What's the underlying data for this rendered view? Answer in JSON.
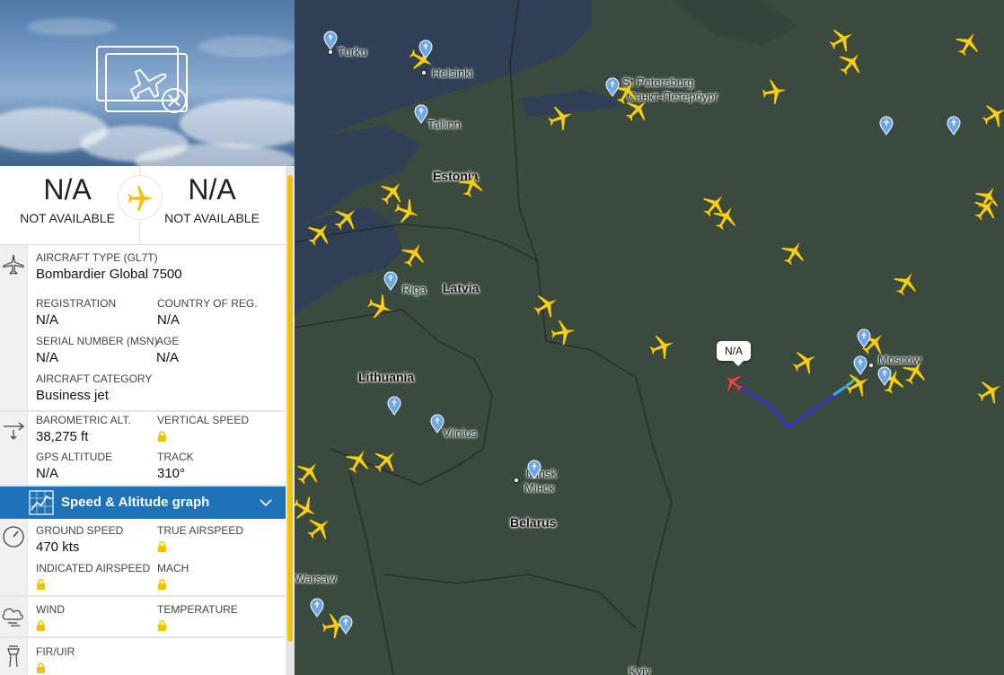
{
  "route": {
    "origin_code": "N/A",
    "origin_name": "NOT AVAILABLE",
    "destination_code": "N/A",
    "destination_name": "NOT AVAILABLE"
  },
  "aircraft": {
    "type_label": "AIRCRAFT TYPE (GL7T)",
    "type_value": "Bombardier Global 7500",
    "registration_label": "REGISTRATION",
    "registration_value": "N/A",
    "country_label": "COUNTRY OF REG.",
    "country_value": "N/A",
    "serial_label": "SERIAL NUMBER (MSN)",
    "serial_value": "N/A",
    "age_label": "AGE",
    "age_value": "N/A",
    "category_label": "AIRCRAFT CATEGORY",
    "category_value": "Business jet"
  },
  "altitude": {
    "baro_label": "BAROMETRIC ALT.",
    "baro_value": "38,275 ft",
    "vs_label": "VERTICAL SPEED",
    "gps_label": "GPS ALTITUDE",
    "gps_value": "N/A",
    "track_label": "TRACK",
    "track_value": "310°"
  },
  "graph_button": {
    "label": "Speed & Altitude graph"
  },
  "speed": {
    "ground_label": "GROUND SPEED",
    "ground_value": "470 kts",
    "tas_label": "TRUE AIRSPEED",
    "ias_label": "INDICATED AIRSPEED",
    "mach_label": "MACH"
  },
  "weather": {
    "wind_label": "WIND",
    "temp_label": "TEMPERATURE"
  },
  "fir": {
    "label": "FIR/UIR"
  },
  "map": {
    "selected_flight_label": "N/A",
    "cities": [
      "Turku",
      "Helsinki",
      "St Petersburg",
      "Санкт-Петербург",
      "Tallinn",
      "Riga",
      "Vilnius",
      "Minsk",
      "Мінск",
      "Moscow",
      "Warsaw",
      "Kyiv"
    ],
    "countries": [
      "Estonia",
      "Latvia",
      "Lithuania",
      "Belarus"
    ]
  },
  "colors": {
    "accent": "#f2c200",
    "graph_bar": "#1e73b8",
    "plane": "#f5cf1a"
  }
}
